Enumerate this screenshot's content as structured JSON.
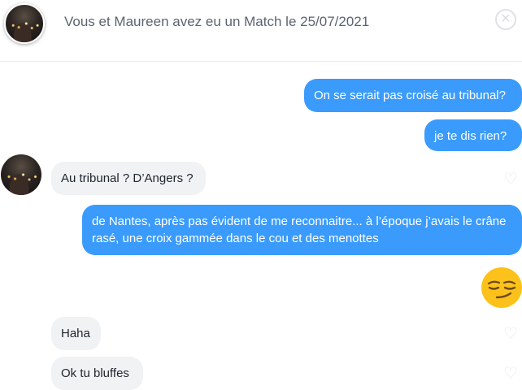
{
  "header": {
    "title": "Vous et Maureen avez eu un Match le 25/07/2021",
    "close_icon": "close-icon"
  },
  "messages": [
    {
      "side": "out",
      "text": "On se serait pas croisé au tribunal?"
    },
    {
      "side": "out",
      "text": "je te dis rien?"
    },
    {
      "side": "in",
      "text": "Au tribunal ? D’Angers ?"
    },
    {
      "side": "out",
      "text": "de Nantes, après pas évident de me reconnaitre... à l’époque j’avais le crâne rasé, une croix gammée dans le cou et des menottes"
    },
    {
      "side": "out",
      "emoji": "smirking-face"
    },
    {
      "side": "in",
      "text": "Haha"
    },
    {
      "side": "in",
      "text": "Ok tu bluffes"
    }
  ],
  "colors": {
    "outgoing_bubble": "#3a9bfd",
    "incoming_bubble": "#f1f2f4"
  }
}
